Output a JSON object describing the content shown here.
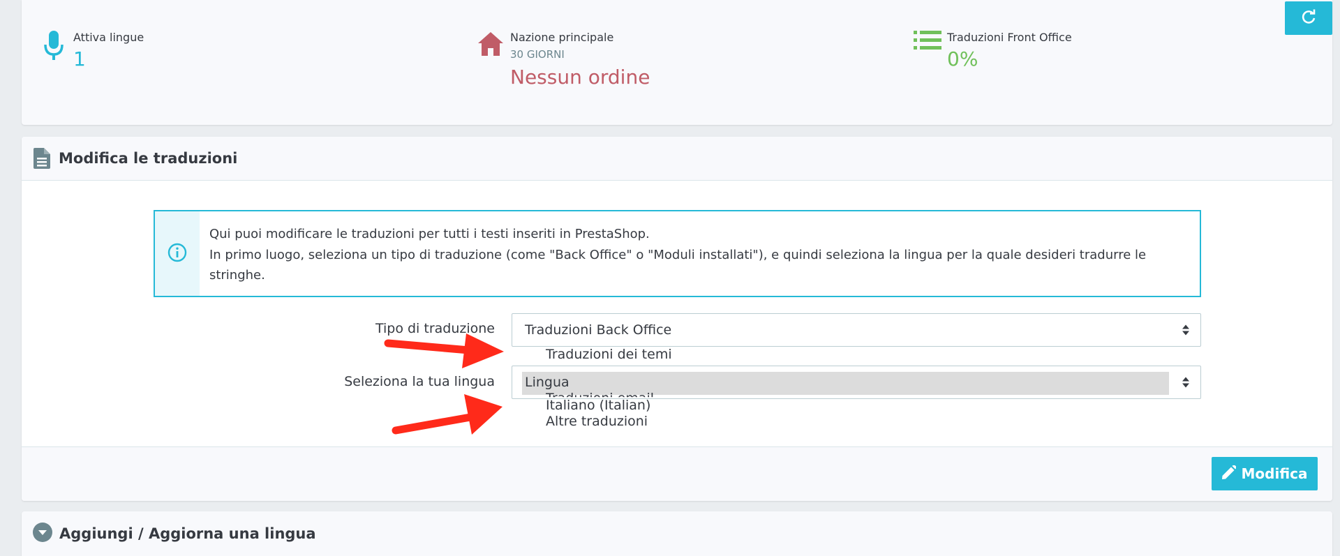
{
  "kpis": {
    "languages": {
      "title": "Attiva lingue",
      "value": "1"
    },
    "country": {
      "title": "Nazione principale",
      "subtitle": "30 GIORNI",
      "value": "Nessun ordine"
    },
    "front_office": {
      "title": "Traduzioni Front Office",
      "value": "0%"
    }
  },
  "colors": {
    "accent": "#25b9d7",
    "danger": "#c05c67",
    "success": "#70c05a",
    "annotation": "#ff2a1a"
  },
  "edit_panel": {
    "title": "Modifica le traduzioni",
    "info_line1": "Qui puoi modificare le traduzioni per tutti i testi inseriti in PrestaShop.",
    "info_line2": "In primo luogo, seleziona un tipo di traduzione (come \"Back Office\" o \"Moduli installati\"), e quindi seleziona la lingua per la quale desideri tradurre le stringhe.",
    "type_label": "Tipo di traduzione",
    "type_selected": "Traduzioni Back Office",
    "language_label": "Seleziona la tua lingua",
    "language_selected": "Lingua",
    "dropdown_options": [
      "Traduzioni dei temi",
      "Traduzioni email",
      "Italiano (Italian)",
      "Altre traduzioni"
    ],
    "submit_label": "Modifica"
  },
  "add_panel": {
    "title": "Aggiungi / Aggiorna una lingua"
  }
}
